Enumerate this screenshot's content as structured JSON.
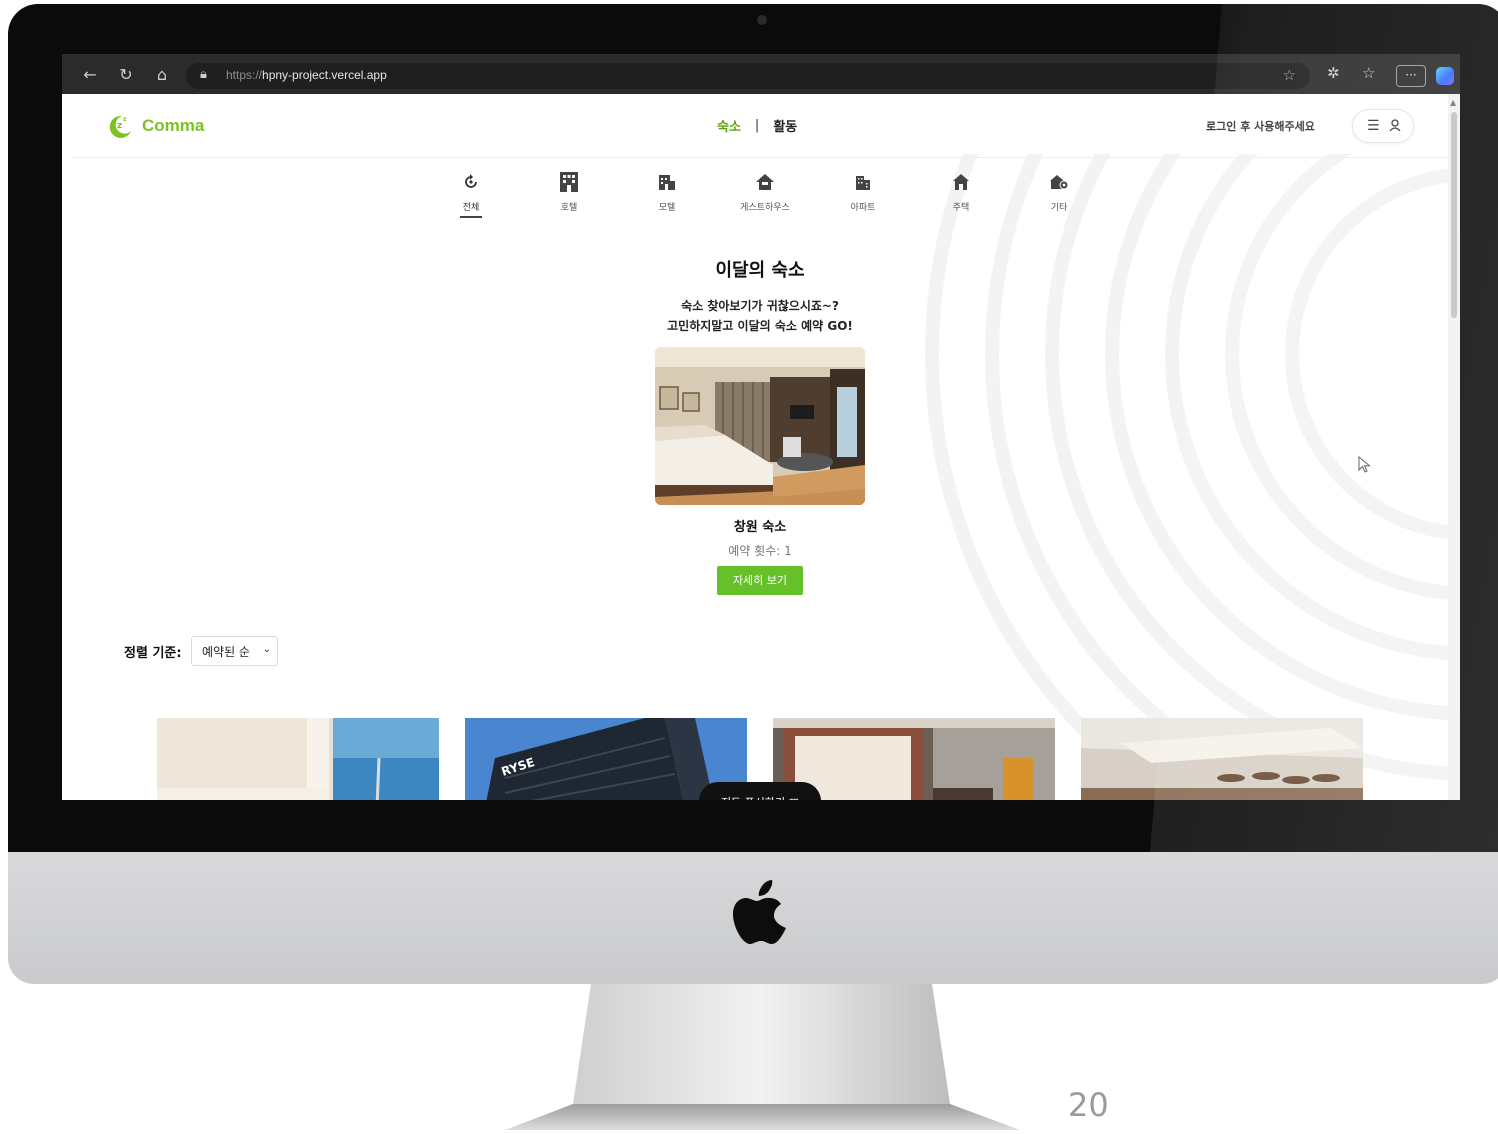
{
  "browser": {
    "url_prefix": "https://",
    "url_domain": "hpny-project.vercel.app",
    "more_label": "···"
  },
  "header": {
    "logo_text": "Comma",
    "tab_lodging": "숙소",
    "tab_separator": "|",
    "tab_activity": "활동",
    "login_message": "로그인 후 사용해주세요"
  },
  "categories": [
    {
      "label": "전체",
      "icon": "refresh-icon",
      "active": true
    },
    {
      "label": "호텔",
      "icon": "hotel-icon",
      "active": false
    },
    {
      "label": "모텔",
      "icon": "motel-icon",
      "active": false
    },
    {
      "label": "게스트하우스",
      "icon": "guesthouse-icon",
      "active": false
    },
    {
      "label": "아파트",
      "icon": "apartment-icon",
      "active": false
    },
    {
      "label": "주택",
      "icon": "house-icon",
      "active": false
    },
    {
      "label": "기타",
      "icon": "other-icon",
      "active": false
    }
  ],
  "featured": {
    "title": "이달의 숙소",
    "subtitle_line1": "숙소 찾아보기가 귀찮으시죠~?",
    "subtitle_line2": "고민하지말고 이달의 숙소 예약 GO!",
    "name": "창원 숙소",
    "booking_count": "예약 횟수: 1",
    "detail_button": "자세히 보기"
  },
  "sort": {
    "label": "정렬 기준:",
    "selected": "예약된 순"
  },
  "map_button": "지도 표시하기 ▥",
  "slide_number": "20",
  "colors": {
    "brand_green": "#7cc224",
    "button_green": "#66c02a",
    "active_tab_green": "#5aa312"
  }
}
